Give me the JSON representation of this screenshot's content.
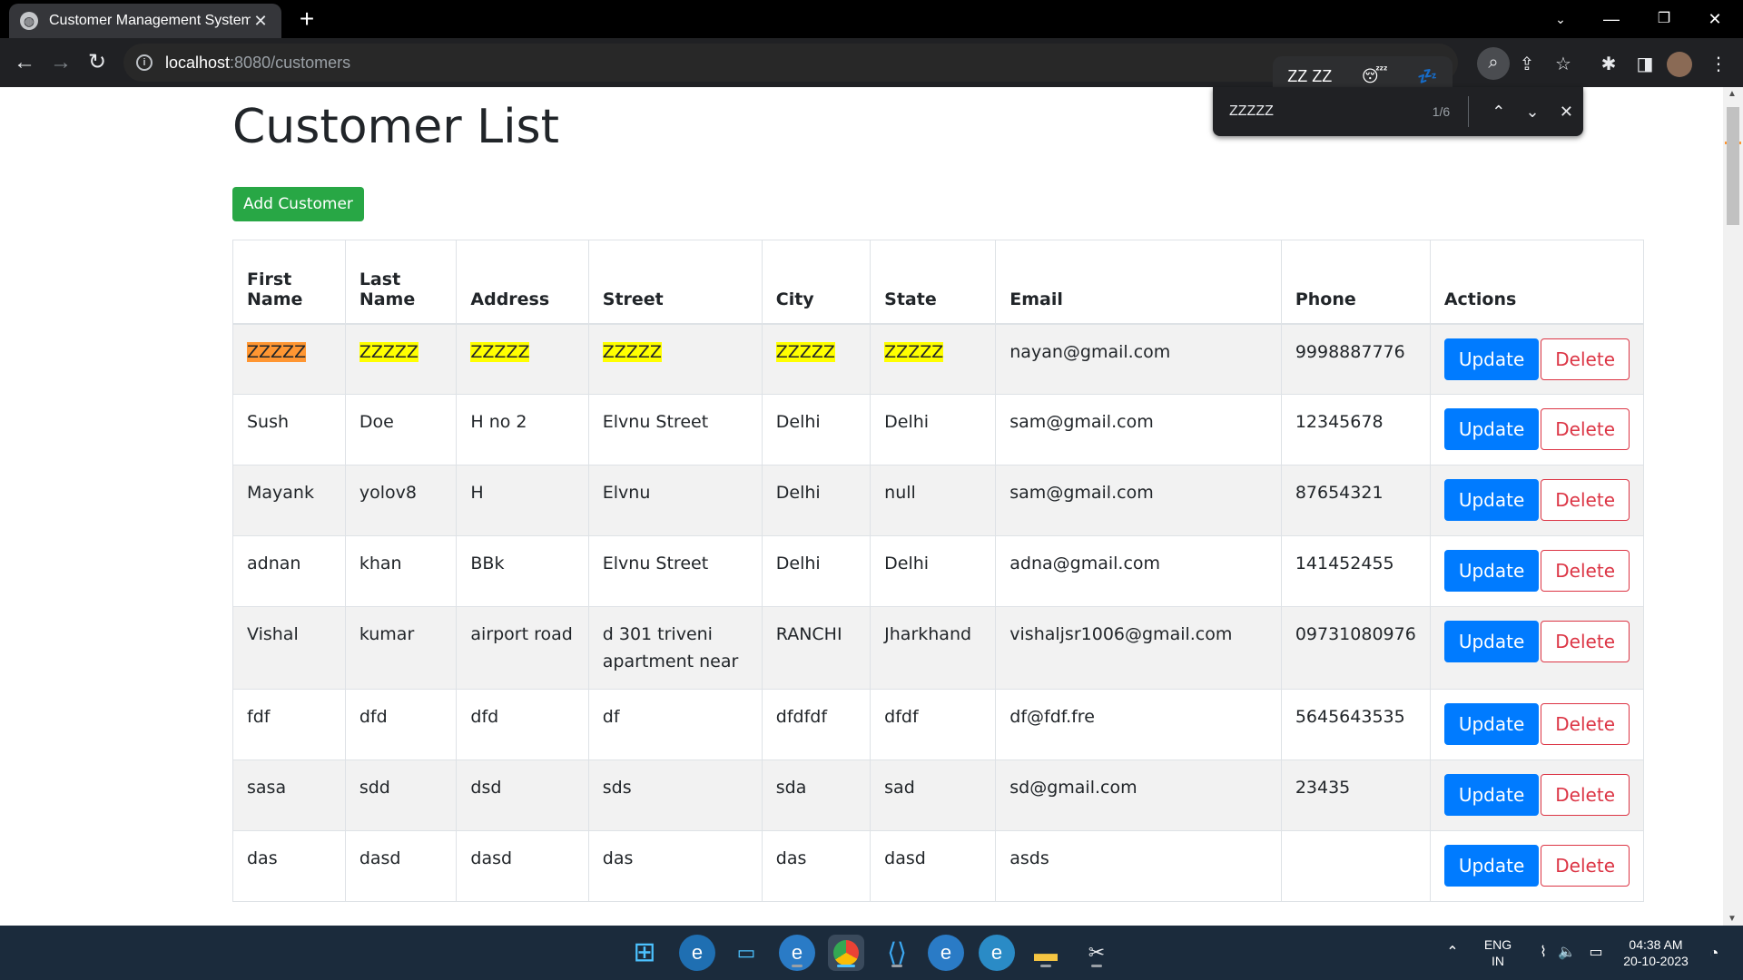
{
  "browser": {
    "tab_title": "Customer Management System",
    "new_tab": "+",
    "url_host": "localhost",
    "url_rest": ":8080/customers",
    "find": {
      "query": "ZZZZZ",
      "count": "1/6"
    },
    "suggestion_text": "ZZ ZZ"
  },
  "page": {
    "title": "Customer List",
    "add_button": "Add Customer"
  },
  "table": {
    "headers": [
      "First Name",
      "Last Name",
      "Address",
      "Street",
      "City",
      "State",
      "Email",
      "Phone",
      "Actions"
    ],
    "rows": [
      {
        "first_name": "ZZZZZ",
        "last_name": "ZZZZZ",
        "address": "ZZZZZ",
        "street": "ZZZZZ",
        "city": "ZZZZZ",
        "state": "ZZZZZ",
        "email": "nayan@gmail.com",
        "phone": "9998887776"
      },
      {
        "first_name": "Sush",
        "last_name": "Doe",
        "address": "H no 2",
        "street": "Elvnu Street",
        "city": "Delhi",
        "state": "Delhi",
        "email": "sam@gmail.com",
        "phone": "12345678"
      },
      {
        "first_name": "Mayank",
        "last_name": "yolov8",
        "address": "H",
        "street": "Elvnu",
        "city": "Delhi",
        "state": "null",
        "email": "sam@gmail.com",
        "phone": "87654321"
      },
      {
        "first_name": "adnan",
        "last_name": "khan",
        "address": "BBk",
        "street": "Elvnu Street",
        "city": "Delhi",
        "state": "Delhi",
        "email": "adna@gmail.com",
        "phone": "141452455"
      },
      {
        "first_name": "Vishal",
        "last_name": "kumar",
        "address": "airport road",
        "street": "d 301 triveni apartment near",
        "city": "RANCHI",
        "state": "Jharkhand",
        "email": "vishaljsr1006@gmail.com",
        "phone": "09731080976"
      },
      {
        "first_name": "fdf",
        "last_name": "dfd",
        "address": "dfd",
        "street": "df",
        "city": "dfdfdf",
        "state": "dfdf",
        "email": "df@fdf.fre",
        "phone": "5645643535"
      },
      {
        "first_name": "sasa",
        "last_name": "sdd",
        "address": "dsd",
        "street": "sds",
        "city": "sda",
        "state": "sad",
        "email": "sd@gmail.com",
        "phone": "23435"
      },
      {
        "first_name": "das",
        "last_name": "dasd",
        "address": "dasd",
        "street": "das",
        "city": "das",
        "state": "dasd",
        "email": "asds",
        "phone": ""
      }
    ],
    "update_label": "Update",
    "delete_label": "Delete"
  },
  "taskbar": {
    "lang_top": "ENG",
    "lang_bottom": "IN",
    "time": "04:38 AM",
    "date": "20-10-2023"
  },
  "colors": {
    "highlight": "#ffff00",
    "highlight_active": "#ff9632",
    "add_button": "#28a745",
    "update_button": "#007bff",
    "delete_button": "#dc3545"
  }
}
